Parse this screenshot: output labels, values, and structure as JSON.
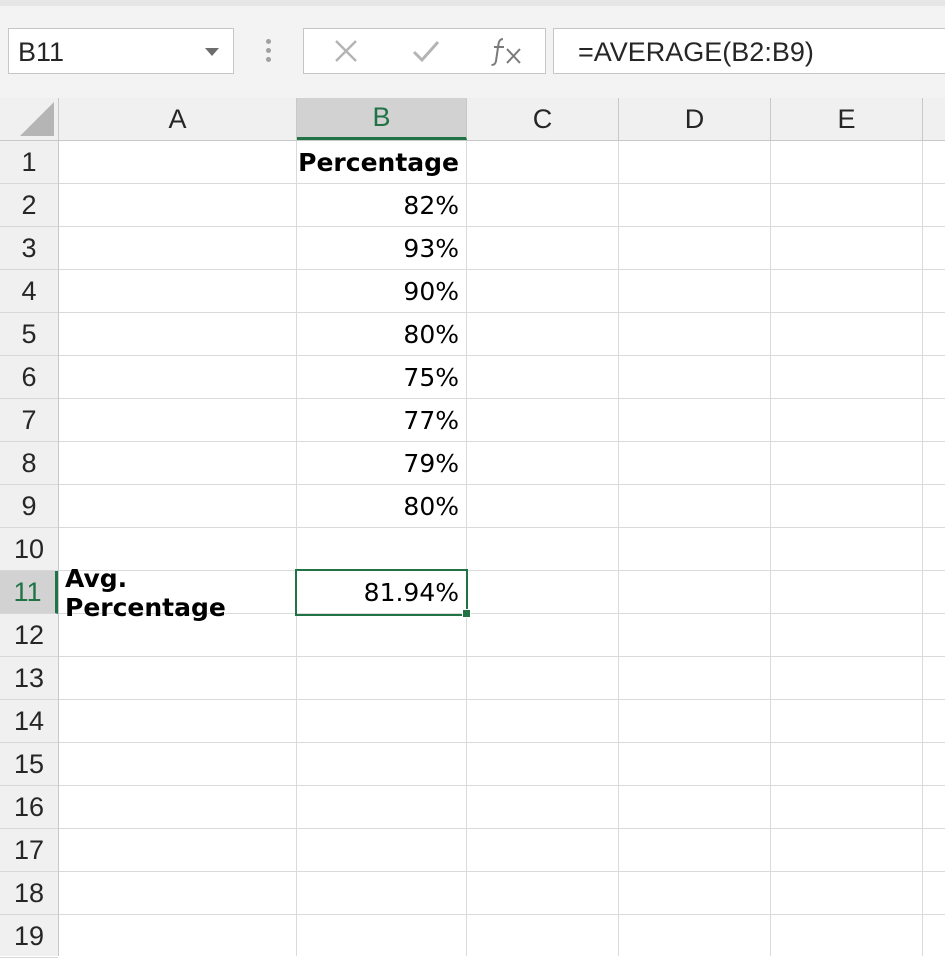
{
  "name_box": {
    "value": "B11"
  },
  "formula_bar": {
    "formula": "=AVERAGE(B2:B9)"
  },
  "icons": {
    "cancel": "close-icon",
    "enter": "check-icon",
    "function": "fx-icon",
    "dropdown": "chevron-down-icon"
  },
  "columns": [
    "A",
    "B",
    "C",
    "D",
    "E"
  ],
  "rows": [
    "1",
    "2",
    "3",
    "4",
    "5",
    "6",
    "7",
    "8",
    "9",
    "10",
    "11",
    "12",
    "13",
    "14",
    "15",
    "16",
    "17",
    "18",
    "19"
  ],
  "cells": {
    "B1": "Percentage",
    "B2": "82%",
    "B3": "93%",
    "B4": "90%",
    "B5": "80%",
    "B6": "75%",
    "B7": "77%",
    "B8": "79%",
    "B9": "80%",
    "A11": "Avg. Percentage",
    "B11": "81.94%"
  },
  "selected_cell": "B11",
  "colors": {
    "accent": "#217346",
    "header_bg": "#f0f0f0",
    "selected_header_bg": "#d2d2d2",
    "gridline": "#dadada"
  }
}
